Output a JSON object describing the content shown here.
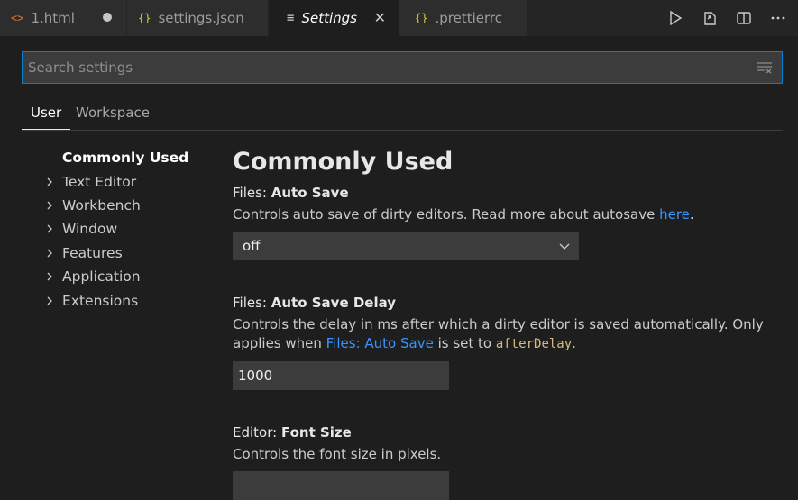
{
  "tabs": [
    {
      "icon": "<>",
      "label": "1.html",
      "state": "dirty",
      "icon_color": "#e37933"
    },
    {
      "icon": "{}",
      "label": "settings.json",
      "state": "normal",
      "icon_color": "#cbcb41"
    },
    {
      "icon": "≡",
      "label": "Settings",
      "state": "active",
      "icon_color": "#cccccc"
    },
    {
      "icon": "{}",
      "label": ".prettierrc",
      "state": "normal",
      "icon_color": "#cbcb41"
    }
  ],
  "tab_close_glyph": "✕",
  "editor_actions": [
    "run-icon",
    "open-settings-json-icon",
    "split-editor-icon",
    "more-actions-icon"
  ],
  "search": {
    "placeholder": "Search settings",
    "value": ""
  },
  "scopes": {
    "user": "User",
    "workspace": "Workspace",
    "selected": "User"
  },
  "toc": {
    "selected": "Commonly Used",
    "groups": [
      "Text Editor",
      "Workbench",
      "Window",
      "Features",
      "Application",
      "Extensions"
    ]
  },
  "section": {
    "title": "Commonly Used"
  },
  "settings": {
    "auto_save": {
      "category": "Files: ",
      "name": "Auto Save",
      "desc_before": "Controls auto save of dirty editors. Read more about autosave ",
      "link": "here",
      "desc_after": ".",
      "value": "off"
    },
    "auto_save_delay": {
      "category": "Files: ",
      "name": "Auto Save Delay",
      "desc_before": "Controls the delay in ms after which a dirty editor is saved automatically. Only applies when ",
      "link": "Files: Auto Save",
      "desc_middle": " is set to ",
      "code": "afterDelay",
      "desc_after": ".",
      "value": "1000"
    },
    "font_size": {
      "category": "Editor: ",
      "name": "Font Size",
      "description": "Controls the font size in pixels."
    }
  },
  "colors": {
    "accent": "#007fd4",
    "link": "#3794ff",
    "code": "#d7ba7d",
    "background": "#1e1e1e"
  }
}
